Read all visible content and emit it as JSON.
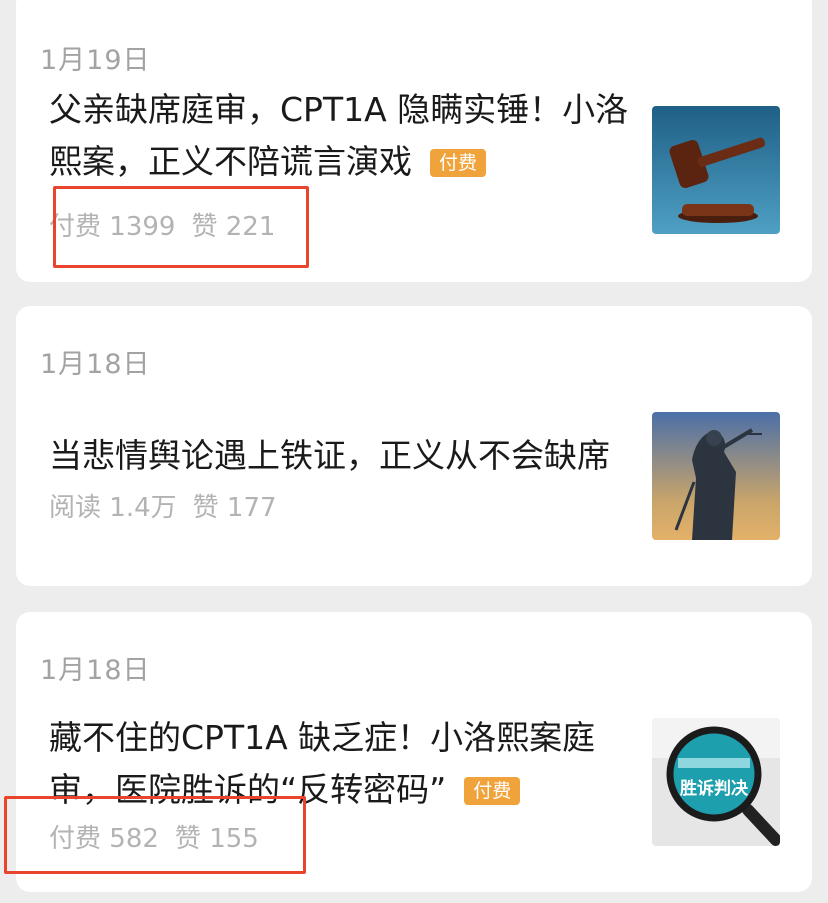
{
  "articles": [
    {
      "date": "1月19日",
      "title": "父亲缺席庭审，CPT1A 隐瞒实锤！小洛熙案，正义不陪谎言演戏",
      "badge": "付费",
      "stat1_label": "付费",
      "stat1_value": "1399",
      "stat2_label": "赞",
      "stat2_value": "221",
      "thumbnail_icon": "gavel-icon"
    },
    {
      "date": "1月18日",
      "title": "当悲情舆论遇上铁证，正义从不会缺席",
      "stat1_label": "阅读",
      "stat1_value": "1.4万",
      "stat2_label": "赞",
      "stat2_value": "177",
      "thumbnail_icon": "lady-justice-statue-icon"
    },
    {
      "date": "1月18日",
      "title": "藏不住的CPT1A 缺乏症！小洛熙案庭审，医院胜诉的“反转密码”",
      "badge": "付费",
      "stat1_label": "付费",
      "stat1_value": "582",
      "stat2_label": "赞",
      "stat2_value": "155",
      "thumbnail_icon": "magnifier-icon",
      "thumbnail_text": "胜诉判决"
    }
  ],
  "colors": {
    "background": "#ededed",
    "card": "#ffffff",
    "badge": "#f0a33a",
    "highlight_box": "#e8452c",
    "meta_text": "#b3b3b3"
  }
}
